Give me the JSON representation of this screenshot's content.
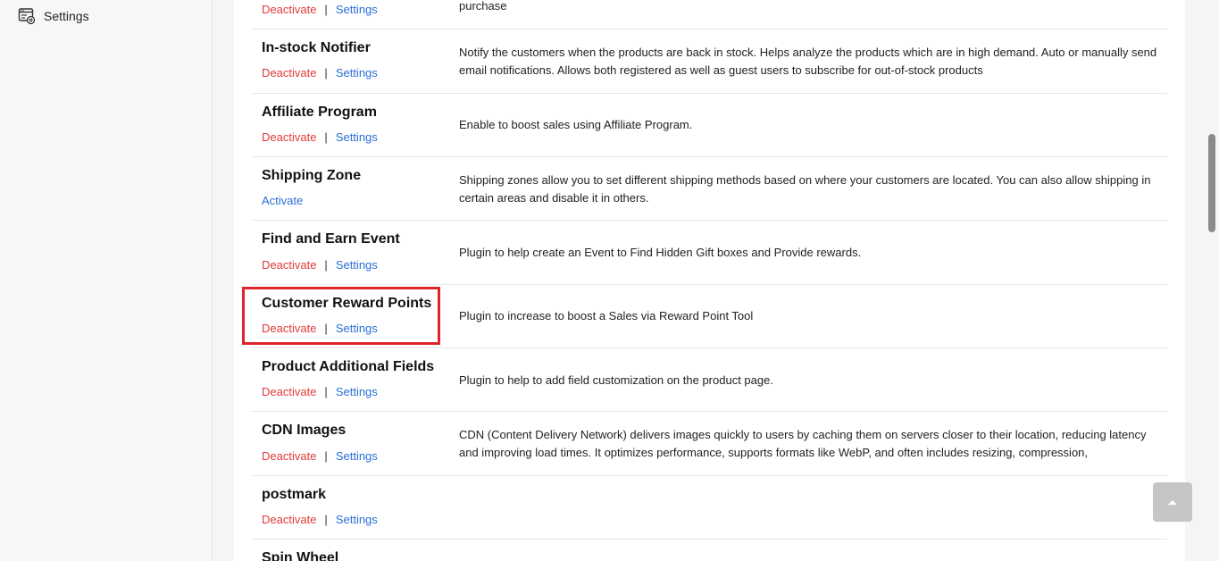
{
  "sidebar": {
    "settings_label": "Settings",
    "settings_icon": "settings-window-icon"
  },
  "plugins": [
    {
      "name": "",
      "action": "Deactivate",
      "settings": "Settings",
      "separator": "|",
      "description": "purchase"
    },
    {
      "name": "In-stock Notifier",
      "action": "Deactivate",
      "settings": "Settings",
      "separator": "|",
      "description": "Notify the customers when the products are back in stock. Helps analyze the products which are in high demand. Auto or manually send email notifications. Allows both registered as well as guest users to subscribe for out-of-stock products"
    },
    {
      "name": "Affiliate Program",
      "action": "Deactivate",
      "settings": "Settings",
      "separator": "|",
      "description": "Enable to boost sales using Affiliate Program."
    },
    {
      "name": "Shipping Zone",
      "action": "Activate",
      "settings": "",
      "separator": "",
      "description": "Shipping zones allow you to set different shipping methods based on where your customers are located. You can also allow shipping in certain areas and disable it in others."
    },
    {
      "name": "Find and Earn Event",
      "action": "Deactivate",
      "settings": "Settings",
      "separator": "|",
      "description": "Plugin to help create an Event to Find Hidden Gift boxes and Provide rewards."
    },
    {
      "name": "Customer Reward Points",
      "action": "Deactivate",
      "settings": "Settings",
      "separator": "|",
      "description": "Plugin to increase to boost a Sales via Reward Point Tool"
    },
    {
      "name": "Product Additional Fields",
      "action": "Deactivate",
      "settings": "Settings",
      "separator": "|",
      "description": "Plugin to help to add field customization on the product page."
    },
    {
      "name": "CDN Images",
      "action": "Deactivate",
      "settings": "Settings",
      "separator": "|",
      "description": "CDN (Content Delivery Network) delivers images quickly to users by caching them on servers closer to their location, reducing latency and improving load times. It optimizes performance, supports formats like WebP, and often includes resizing, compression,"
    },
    {
      "name": "postmark",
      "action": "Deactivate",
      "settings": "Settings",
      "separator": "|",
      "description": ""
    },
    {
      "name": "Spin Wheel",
      "action": "",
      "settings": "",
      "separator": "",
      "description": ""
    }
  ],
  "colors": {
    "deactivate": "#e03a3a",
    "link": "#2a6fd6",
    "highlight": "#e0242c"
  },
  "scroll_top_icon": "chevron-up-icon"
}
